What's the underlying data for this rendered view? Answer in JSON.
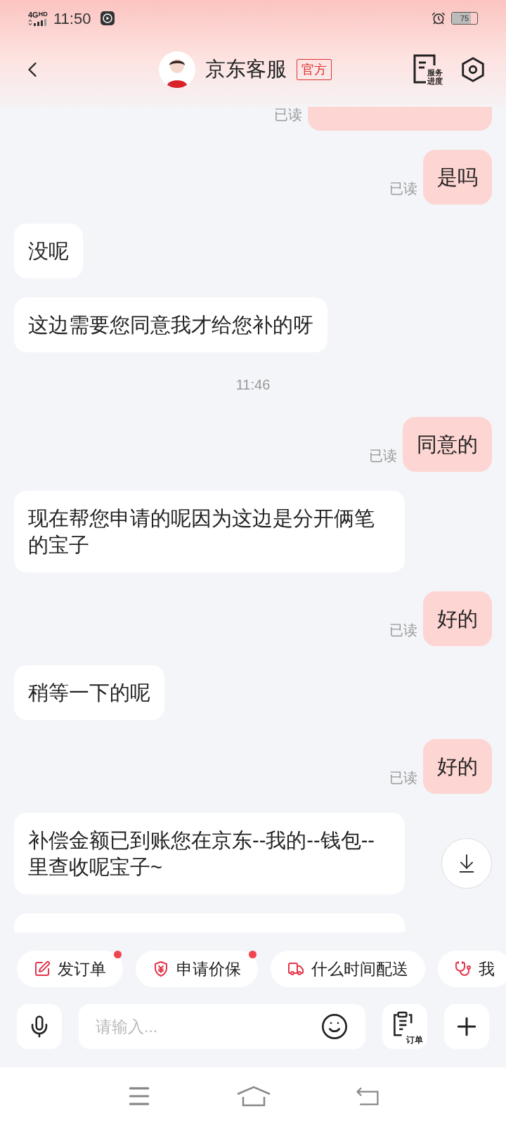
{
  "status_bar": {
    "network": "4G",
    "network_hd": "HD",
    "time": "11:50",
    "battery": "75"
  },
  "header": {
    "title": "京东客服",
    "badge": "官方",
    "progress_label_top": "服务",
    "progress_label_bottom": "进度"
  },
  "messages": [
    {
      "kind": "sent",
      "read_label": "已读"
    },
    {
      "kind": "sent",
      "text": "是吗",
      "read_label": "已读"
    },
    {
      "kind": "received",
      "text": "没呢"
    },
    {
      "kind": "received",
      "text": "这边需要您同意我才给您补的呀"
    },
    {
      "kind": "time",
      "text": "11:46"
    },
    {
      "kind": "sent",
      "text": "同意的",
      "read_label": "已读"
    },
    {
      "kind": "received",
      "text": "现在帮您申请的呢因为这边是分开俩笔的宝子"
    },
    {
      "kind": "sent",
      "text": "好的",
      "read_label": "已读"
    },
    {
      "kind": "received",
      "text": "稍等一下的呢"
    },
    {
      "kind": "sent",
      "text": "好的",
      "read_label": "已读"
    },
    {
      "kind": "received",
      "text": "补偿金额已到账您在京东--我的--钱包--里查收呢宝子~"
    },
    {
      "kind": "received"
    }
  ],
  "quick_actions": [
    {
      "kind": "order",
      "label": "发订单",
      "dot": true
    },
    {
      "kind": "price",
      "label": "申请价保",
      "dot": true
    },
    {
      "kind": "delivery",
      "label": "什么时间配送",
      "dot": false
    },
    {
      "kind": "repair",
      "label": "我",
      "dot": false
    }
  ],
  "input": {
    "placeholder": "请输入...",
    "order_label": "订单"
  }
}
